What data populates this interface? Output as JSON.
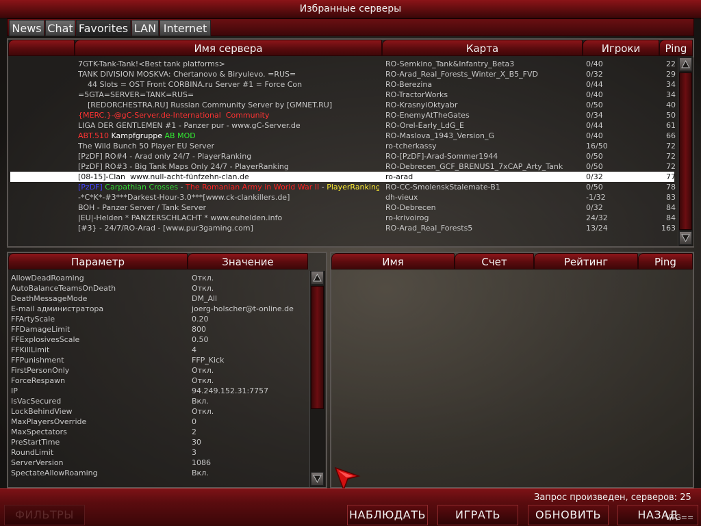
{
  "window": {
    "title": "Избранные серверы"
  },
  "tabs": [
    "News",
    "Chat",
    "Favorites",
    "LAN",
    "Internet"
  ],
  "server_list": {
    "columns": {
      "name": "Имя сервера",
      "map": "Карта",
      "players": "Игроки",
      "ping": "Ping"
    },
    "rows": [
      {
        "name": "7GTK-Tank-Tank!<Best tank platforms>",
        "map": "RO-Semkino_Tank&Infantry_Beta3",
        "players": "0/40",
        "ping": "22"
      },
      {
        "name": "TANK DIVISION MOSKVA: Chertanovo & Biryulevo. =RUS=",
        "map": "RO-Arad_Real_Forests_Winter_X_B5_FVD",
        "players": "0/32",
        "ping": "29"
      },
      {
        "name": "    44 Slots = OST Front CORBINA.ru Server #1 = Force Con",
        "map": "RO-Berezina",
        "players": "0/44",
        "ping": "34"
      },
      {
        "name": "=5GTA=SERVER=TANK=RUS=",
        "map": "RO-TractorWorks",
        "players": "0/40",
        "ping": "34"
      },
      {
        "name": "    [REDORCHESTRA.RU] Russian Community Server by [GMNET.RU]",
        "map": "RO-KrasnyiOktyabr",
        "players": "0/50",
        "ping": "40"
      },
      {
        "name": "{MERC.}-@gC-Server.de-International  Community",
        "map": "RO-EnemyAtTheGates",
        "players": "0/34",
        "ping": "50",
        "color": "#ff3333"
      },
      {
        "name": "LIGA DER GENTLEMEN #1 - Panzer pur - www.gC-Server.de",
        "map": "RO-Orel-Early_LdG_E",
        "players": "0/44",
        "ping": "61"
      },
      {
        "name": "",
        "name_parts": [
          {
            "text": "ABT.510 ",
            "color": "#ff3333"
          },
          {
            "text": "Kampfgruppe ",
            "color": "#ffffff"
          },
          {
            "text": "AB MOD",
            "color": "#33ee33"
          }
        ],
        "map": "RO-Maslova_1943_Version_G",
        "players": "0/40",
        "ping": "66"
      },
      {
        "name": "The Wild Bunch 50 Player EU Server",
        "map": "ro-tcherkassy",
        "players": "16/50",
        "ping": "72"
      },
      {
        "name": "[PzDF] RO#4 - Arad only 24/7 - PlayerRanking",
        "map": "RO-[PzDF]-Arad-Sommer1944",
        "players": "0/50",
        "ping": "72"
      },
      {
        "name": "[PzDF] RO#3 - Big Tank Maps Only 24/7 - PlayerRanking",
        "map": "RO-Debrecen_GCF_BRENUS1_7xCAP_Arty_Tank",
        "players": "0/50",
        "ping": "72"
      },
      {
        "name": "[08-15]-Clan  www.null-acht-fünfzehn-clan.de",
        "map": "ro-arad",
        "players": "0/32",
        "ping": "77",
        "selected": true
      },
      {
        "name": "",
        "name_parts": [
          {
            "text": "[PzDF] ",
            "color": "#4444ff"
          },
          {
            "text": "Carpathian Crosses ",
            "color": "#33dd33"
          },
          {
            "text": "- ",
            "color": "#c8c8c8"
          },
          {
            "text": "The Romanian Army in World War II ",
            "color": "#ff2222"
          },
          {
            "text": "- ",
            "color": "#c8c8c8"
          },
          {
            "text": "PlayerRanking",
            "color": "#ffee33"
          }
        ],
        "map": "RO-CC-SmolenskStalemate-B1",
        "players": "0/50",
        "ping": "78"
      },
      {
        "name": "-*C*K*-#3***Darkest-Hour-3.0***[www.ck-clankillers.de]",
        "map": "dh-vieux",
        "players": "-1/32",
        "ping": "83"
      },
      {
        "name": "BOH - Panzer Server / Tank Server",
        "map": "RO-Debrecen",
        "players": "0/32",
        "ping": "84"
      },
      {
        "name": "|EU|-Helden * PANZERSCHLACHT * www.euhelden.info",
        "map": "ro-krivoirog",
        "players": "24/32",
        "ping": "84"
      },
      {
        "name": "[#3} - 24/7/RO-Arad - [www.pur3gaming.com]",
        "map": "RO-Arad_Real_Forests5",
        "players": "13/24",
        "ping": "163"
      }
    ]
  },
  "rules_panel": {
    "columns": {
      "param": "Параметр",
      "value": "Значение"
    },
    "rows": [
      {
        "param": "AllowDeadRoaming",
        "value": "Откл."
      },
      {
        "param": "AutoBalanceTeamsOnDeath",
        "value": "Откл."
      },
      {
        "param": "DeathMessageMode",
        "value": "DM_All"
      },
      {
        "param": "E-mail администратора",
        "value": "joerg-holscher@t-online.de"
      },
      {
        "param": "FFArtyScale",
        "value": "0.20"
      },
      {
        "param": "FFDamageLimit",
        "value": "800"
      },
      {
        "param": "FFExplosivesScale",
        "value": "0.50"
      },
      {
        "param": "FFKillLimit",
        "value": "4"
      },
      {
        "param": "FFPunishment",
        "value": "FFP_Kick"
      },
      {
        "param": "FirstPersonOnly",
        "value": "Откл."
      },
      {
        "param": "ForceRespawn",
        "value": "Откл."
      },
      {
        "param": "IP",
        "value": "94.249.152.31:7757"
      },
      {
        "param": "IsVacSecured",
        "value": "Вкл."
      },
      {
        "param": "LockBehindView",
        "value": "Откл."
      },
      {
        "param": "MaxPlayersOverride",
        "value": "0"
      },
      {
        "param": "MaxSpectators",
        "value": "2"
      },
      {
        "param": "PreStartTime",
        "value": "30"
      },
      {
        "param": "RoundLimit",
        "value": "3"
      },
      {
        "param": "ServerVersion",
        "value": "1086"
      },
      {
        "param": "SpectateAllowRoaming",
        "value": "Вкл."
      }
    ]
  },
  "players_panel": {
    "columns": {
      "name": "Имя",
      "score": "Счет",
      "rating": "Рейтинг",
      "ping": "Ping"
    }
  },
  "status": {
    "text": "Запрос произведен, серверов: 25"
  },
  "buttons": {
    "filters": "ФИЛЬТРЫ",
    "spectate": "НАБЛЮДАТЬ",
    "play": "ИГРАТЬ",
    "refresh": "ОБНОВИТЬ",
    "back": "НАЗАД"
  },
  "watermark": "VTG==",
  "icons": {
    "scroll_up": "arrow-up-icon",
    "scroll_down": "arrow-down-icon",
    "cursor": "pointer-cursor-icon"
  },
  "colors": {
    "header_red": "#8c1519",
    "selected_row": "#ffffff"
  }
}
